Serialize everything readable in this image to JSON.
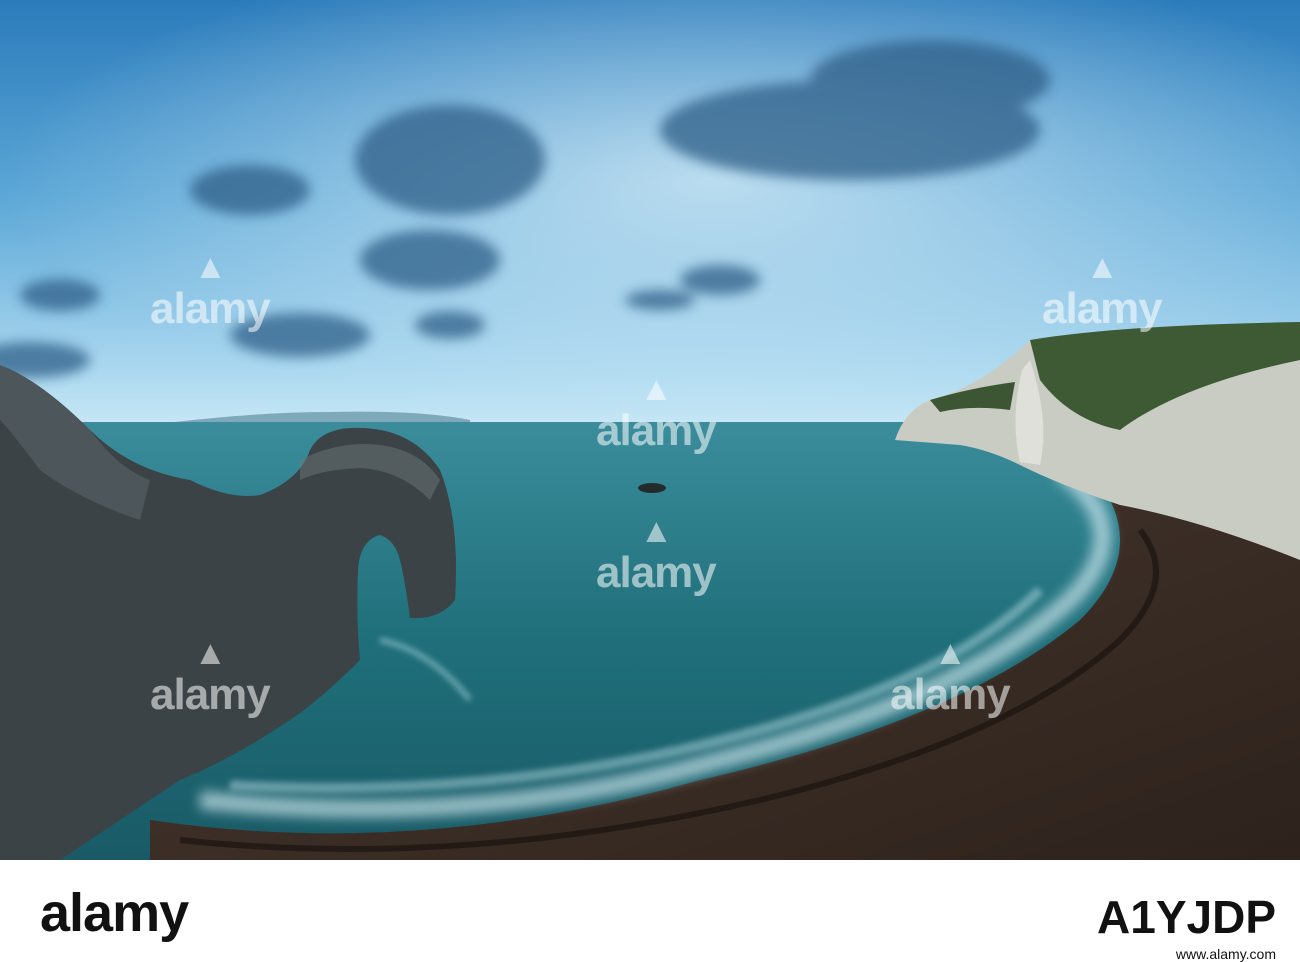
{
  "photo": {
    "subject": "coastal-arch-bay",
    "colors": {
      "sky_top": "#2f7fbc",
      "sky_horizon": "#bfe2f4",
      "sea": "#1f6e78",
      "rock": "#3b4346",
      "cliff": "#c9ccc3",
      "beach": "#3a2c25"
    }
  },
  "watermarks": [
    "alamy",
    "alamy",
    "alamy",
    "alamy",
    "alamy",
    "alamy"
  ],
  "footer": {
    "logo": "alamy",
    "code": "A1YJDP",
    "url": "www.alamy.com"
  }
}
